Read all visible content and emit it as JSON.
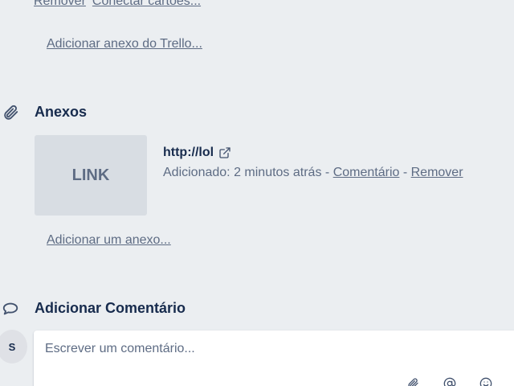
{
  "checklist_links": {
    "remove_label": "Remover",
    "connect_cards_label": "Conectar cartões..."
  },
  "trello_attachment": {
    "add_label": "Adicionar anexo do Trello..."
  },
  "attachments": {
    "title": "Anexos",
    "items": [
      {
        "thumb_label": "LINK",
        "name": "http://lol",
        "added_text": "Adicionado: 2 minutos atrás",
        "separator": "-",
        "comment_label": "Comentário",
        "remove_label": "Remover"
      }
    ],
    "add_label": "Adicionar um anexo..."
  },
  "comment": {
    "title": "Adicionar Comentário",
    "avatar_initial": "S",
    "placeholder": "Escrever um comentário..."
  },
  "icons": {
    "attachments_section": "paperclip-icon",
    "external_link": "external-link-icon",
    "comment_section": "comment-icon",
    "attach": "paperclip-icon",
    "mention": "at-icon",
    "emoji": "emoji-icon"
  },
  "colors": {
    "background": "#ebeef1",
    "text": "#172b4d",
    "muted": "#5e6c84",
    "thumb": "#d8dde3"
  }
}
